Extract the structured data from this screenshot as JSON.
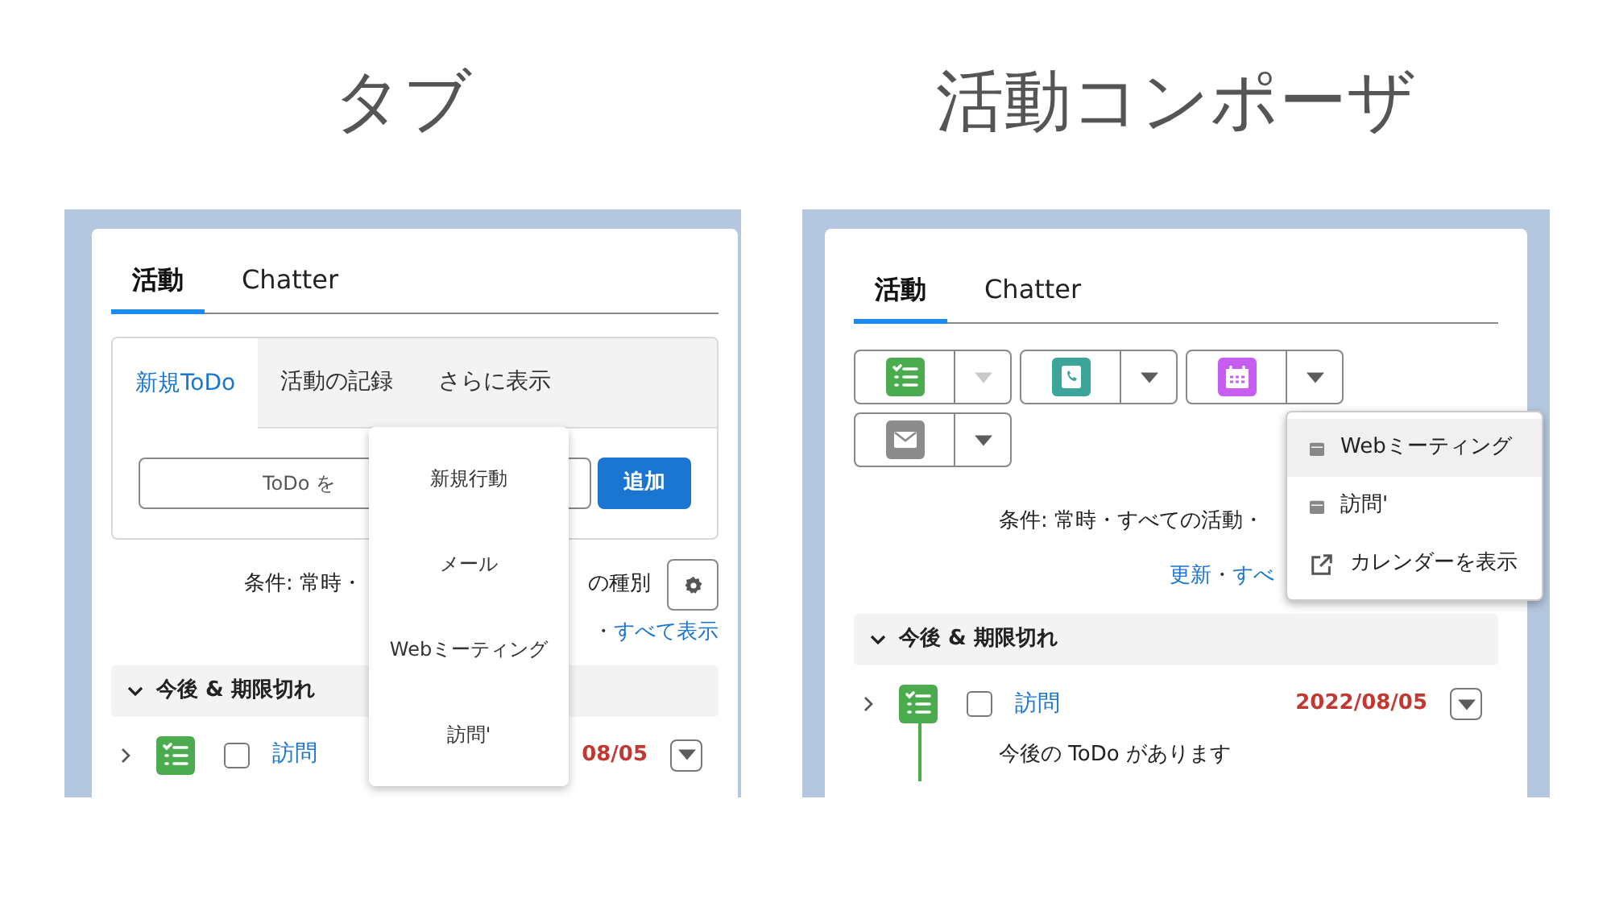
{
  "tab_view": {
    "title": "タブ",
    "tabs": [
      {
        "label": "活動",
        "selected": true
      },
      {
        "label": "Chatter",
        "selected": false
      }
    ],
    "composer_tabs": [
      {
        "label": "新規ToDo",
        "selected": true
      },
      {
        "label": "活動の記録",
        "selected": false
      },
      {
        "label": "さらに表示",
        "selected": false
      }
    ],
    "input": {
      "placeholder": "ToDo を"
    },
    "add_button": "追加",
    "filter_left": "条件: 常時・",
    "filter_right": "の種別",
    "separator": "・",
    "link": "すべて表示",
    "section": {
      "label": "今後 & 期限切れ",
      "expanded": true
    },
    "task": {
      "subject": "訪問",
      "date": "08/05",
      "checked": false,
      "expanded": false
    },
    "menu": {
      "items": [
        {
          "label": "新規行動"
        },
        {
          "label": "メール"
        },
        {
          "label": "Webミーティング"
        },
        {
          "label": "訪問'"
        }
      ]
    }
  },
  "composer_view": {
    "title": "活動コンポーザ",
    "tabs": [
      {
        "label": "活動",
        "selected": true
      },
      {
        "label": "Chatter",
        "selected": false
      }
    ],
    "actions": [
      {
        "kind": "task",
        "disabled": true
      },
      {
        "kind": "call",
        "disabled": false
      },
      {
        "kind": "event",
        "disabled": false
      },
      {
        "kind": "email",
        "disabled": false
      }
    ],
    "filter": "条件: 常時・すべての活動・",
    "links": [
      "更新",
      "すべ"
    ],
    "separator": "・",
    "menu": {
      "items": [
        {
          "label": "Webミーティング",
          "kind": "event",
          "selected": true
        },
        {
          "label": "訪問'",
          "kind": "event",
          "selected": false
        },
        {
          "label": "カレンダーを表示",
          "kind": "external",
          "selected": false
        }
      ]
    },
    "section": {
      "label": "今後 & 期限切れ",
      "expanded": true
    },
    "task": {
      "subject": "訪問",
      "date": "2022/08/05",
      "checked": false,
      "expanded": false,
      "description": "今後の ToDo があります"
    }
  }
}
